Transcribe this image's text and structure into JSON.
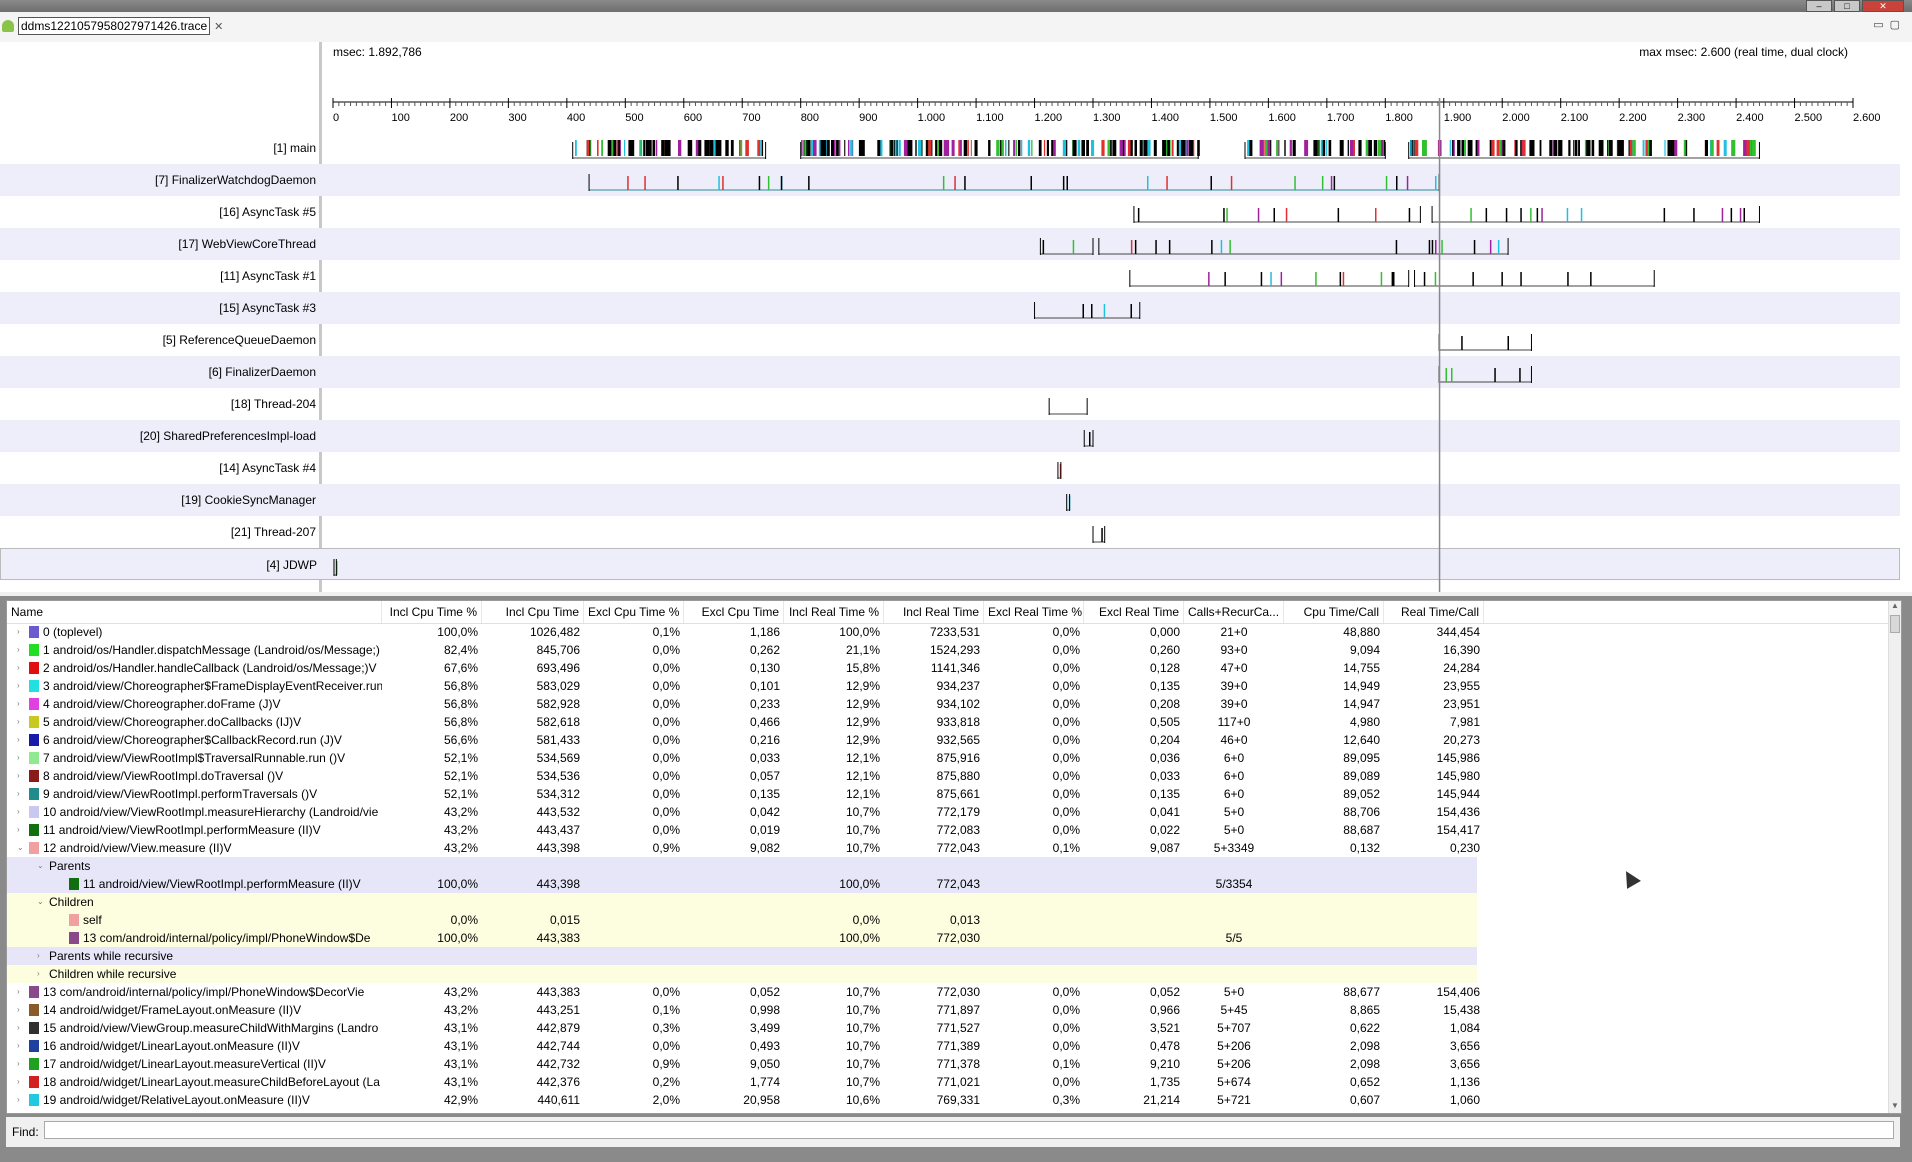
{
  "window": {
    "buttons": [
      "–",
      "□",
      "✕"
    ]
  },
  "tab": {
    "title": "ddms1221057958027971426.trace",
    "icon": "android-icon"
  },
  "timeline": {
    "msec_label": "msec: 1.892,786",
    "max_msec_label": "max msec: 2.600 (real time, dual clock)",
    "ticks": [
      "0",
      "100",
      "200",
      "300",
      "400",
      "500",
      "600",
      "700",
      "800",
      "900",
      "1.000",
      "1.100",
      "1.200",
      "1.300",
      "1.400",
      "1.500",
      "1.600",
      "1.700",
      "1.800",
      "1.900",
      "2.000",
      "2.100",
      "2.200",
      "2.300",
      "2.400",
      "2.500",
      "2.600"
    ],
    "max_ms": 2600,
    "cursor_ms": 1892.786,
    "threads": [
      {
        "name": "[1] main",
        "spans": [
          [
            410,
            740
          ],
          [
            800,
            1480
          ],
          [
            1560,
            1800
          ],
          [
            1840,
            2440
          ]
        ]
      },
      {
        "name": "[7] FinalizerWatchdogDaemon",
        "spans": [
          [
            438,
            1892
          ]
        ]
      },
      {
        "name": "[16] AsyncTask #5",
        "spans": [
          [
            1370,
            1860
          ],
          [
            1880,
            2440
          ]
        ]
      },
      {
        "name": "[17] WebViewCoreThread",
        "spans": [
          [
            1210,
            1300
          ],
          [
            1310,
            2010
          ]
        ]
      },
      {
        "name": "[11] AsyncTask #1",
        "spans": [
          [
            1363,
            1840
          ],
          [
            1850,
            2260
          ]
        ]
      },
      {
        "name": "[15] AsyncTask #3",
        "spans": [
          [
            1200,
            1380
          ]
        ]
      },
      {
        "name": "[5] ReferenceQueueDaemon",
        "spans": [
          [
            1892,
            2050
          ]
        ]
      },
      {
        "name": "[6] FinalizerDaemon",
        "spans": [
          [
            1892,
            2050
          ]
        ]
      },
      {
        "name": "[18] Thread-204",
        "spans": [
          [
            1225,
            1290
          ]
        ]
      },
      {
        "name": "[20] SharedPreferencesImpl-load",
        "spans": [
          [
            1285,
            1300
          ]
        ]
      },
      {
        "name": "[14] AsyncTask #4",
        "spans": [
          [
            1240,
            1245
          ]
        ]
      },
      {
        "name": "[19] CookieSyncManager",
        "spans": [
          [
            1255,
            1260
          ]
        ]
      },
      {
        "name": "[21] Thread-207",
        "spans": [
          [
            1300,
            1320
          ]
        ]
      },
      {
        "name": "[4] JDWP",
        "spans": [
          [
            0,
            4
          ]
        ]
      }
    ]
  },
  "table": {
    "headers": [
      "Name",
      "Incl Cpu Time %",
      "Incl Cpu Time",
      "Excl Cpu Time %",
      "Excl Cpu Time",
      "Incl Real Time %",
      "Incl Real Time",
      "Excl Real Time %",
      "Excl Real Time",
      "Calls+RecurCa...",
      "Cpu Time/Call",
      "Real Time/Call"
    ],
    "rows": [
      {
        "kind": "method",
        "twisty": "›",
        "color": "#6a5acd",
        "name": "0 (toplevel)",
        "cells": [
          "100,0%",
          "1026,482",
          "0,1%",
          "1,186",
          "100,0%",
          "7233,531",
          "0,0%",
          "0,000",
          "21+0",
          "48,880",
          "344,454"
        ]
      },
      {
        "kind": "method",
        "twisty": "›",
        "color": "#22dd22",
        "name": "1 android/os/Handler.dispatchMessage (Landroid/os/Message;)",
        "cells": [
          "82,4%",
          "845,706",
          "0,0%",
          "0,262",
          "21,1%",
          "1524,293",
          "0,0%",
          "0,260",
          "93+0",
          "9,094",
          "16,390"
        ]
      },
      {
        "kind": "method",
        "twisty": "›",
        "color": "#e01010",
        "name": "2 android/os/Handler.handleCallback (Landroid/os/Message;)V",
        "cells": [
          "67,6%",
          "693,496",
          "0,0%",
          "0,130",
          "15,8%",
          "1141,346",
          "0,0%",
          "0,128",
          "47+0",
          "14,755",
          "24,284"
        ]
      },
      {
        "kind": "method",
        "twisty": "›",
        "color": "#22e0e0",
        "name": "3 android/view/Choreographer$FrameDisplayEventReceiver.run",
        "cells": [
          "56,8%",
          "583,029",
          "0,0%",
          "0,101",
          "12,9%",
          "934,237",
          "0,0%",
          "0,135",
          "39+0",
          "14,949",
          "23,955"
        ]
      },
      {
        "kind": "method",
        "twisty": "›",
        "color": "#e040e0",
        "name": "4 android/view/Choreographer.doFrame (J)V",
        "cells": [
          "56,8%",
          "582,928",
          "0,0%",
          "0,233",
          "12,9%",
          "934,102",
          "0,0%",
          "0,208",
          "39+0",
          "14,947",
          "23,951"
        ]
      },
      {
        "kind": "method",
        "twisty": "›",
        "color": "#c8c820",
        "name": "5 android/view/Choreographer.doCallbacks (IJ)V",
        "cells": [
          "56,8%",
          "582,618",
          "0,0%",
          "0,466",
          "12,9%",
          "933,818",
          "0,0%",
          "0,505",
          "117+0",
          "4,980",
          "7,981"
        ]
      },
      {
        "kind": "method",
        "twisty": "›",
        "color": "#1a1aa8",
        "name": "6 android/view/Choreographer$CallbackRecord.run (J)V",
        "cells": [
          "56,6%",
          "581,433",
          "0,0%",
          "0,216",
          "12,9%",
          "932,565",
          "0,0%",
          "0,204",
          "46+0",
          "12,640",
          "20,273"
        ]
      },
      {
        "kind": "method",
        "twisty": "›",
        "color": "#90e890",
        "name": "7 android/view/ViewRootImpl$TraversalRunnable.run ()V",
        "cells": [
          "52,1%",
          "534,569",
          "0,0%",
          "0,033",
          "12,1%",
          "875,916",
          "0,0%",
          "0,036",
          "6+0",
          "89,095",
          "145,986"
        ]
      },
      {
        "kind": "method",
        "twisty": "›",
        "color": "#8b1a1a",
        "name": "8 android/view/ViewRootImpl.doTraversal ()V",
        "cells": [
          "52,1%",
          "534,536",
          "0,0%",
          "0,057",
          "12,1%",
          "875,880",
          "0,0%",
          "0,033",
          "6+0",
          "89,089",
          "145,980"
        ]
      },
      {
        "kind": "method",
        "twisty": "›",
        "color": "#208c8c",
        "name": "9 android/view/ViewRootImpl.performTraversals ()V",
        "cells": [
          "52,1%",
          "534,312",
          "0,0%",
          "0,135",
          "12,1%",
          "875,661",
          "0,0%",
          "0,135",
          "6+0",
          "89,052",
          "145,944"
        ]
      },
      {
        "kind": "method",
        "twisty": "›",
        "color": "#c8c8f0",
        "name": "10 android/view/ViewRootImpl.measureHierarchy (Landroid/vie",
        "cells": [
          "43,2%",
          "443,532",
          "0,0%",
          "0,042",
          "10,7%",
          "772,179",
          "0,0%",
          "0,041",
          "5+0",
          "88,706",
          "154,436"
        ]
      },
      {
        "kind": "method",
        "twisty": "›",
        "color": "#107010",
        "name": "11 android/view/ViewRootImpl.performMeasure (II)V",
        "cells": [
          "43,2%",
          "443,437",
          "0,0%",
          "0,019",
          "10,7%",
          "772,083",
          "0,0%",
          "0,022",
          "5+0",
          "88,687",
          "154,417"
        ]
      },
      {
        "kind": "method",
        "twisty": "⌄",
        "color": "#f0a0a0",
        "name": "12 android/view/View.measure (II)V",
        "cells": [
          "43,2%",
          "443,398",
          "0,9%",
          "9,082",
          "10,7%",
          "772,043",
          "0,1%",
          "9,087",
          "5+3349",
          "0,132",
          "0,230"
        ]
      },
      {
        "kind": "group-parents",
        "twisty": "⌄",
        "color": "",
        "name": "Parents",
        "cells": [
          "",
          "",
          "",
          "",
          "",
          "",
          "",
          "",
          "",
          "",
          ""
        ]
      },
      {
        "kind": "sub-parents",
        "twisty": "",
        "color": "#107010",
        "name": "11 android/view/ViewRootImpl.performMeasure (II)V",
        "cells": [
          "100,0%",
          "443,398",
          "",
          "",
          "100,0%",
          "772,043",
          "",
          "",
          "5/3354",
          "",
          ""
        ]
      },
      {
        "kind": "group-children",
        "twisty": "⌄",
        "color": "",
        "name": "Children",
        "cells": [
          "",
          "",
          "",
          "",
          "",
          "",
          "",
          "",
          "",
          "",
          ""
        ]
      },
      {
        "kind": "sub-children",
        "twisty": "",
        "color": "#f0a0a0",
        "name": "self",
        "cells": [
          "0,0%",
          "0,015",
          "",
          "",
          "0,0%",
          "0,013",
          "",
          "",
          "",
          "",
          ""
        ]
      },
      {
        "kind": "sub-children",
        "twisty": "",
        "color": "#8a4a8a",
        "name": "13 com/android/internal/policy/impl/PhoneWindow$De",
        "cells": [
          "100,0%",
          "443,383",
          "",
          "",
          "100,0%",
          "772,030",
          "",
          "",
          "5/5",
          "",
          ""
        ]
      },
      {
        "kind": "group-parents",
        "twisty": "›",
        "color": "",
        "name": "Parents while recursive",
        "cells": [
          "",
          "",
          "",
          "",
          "",
          "",
          "",
          "",
          "",
          "",
          ""
        ]
      },
      {
        "kind": "group-children",
        "twisty": "›",
        "color": "",
        "name": "Children while recursive",
        "cells": [
          "",
          "",
          "",
          "",
          "",
          "",
          "",
          "",
          "",
          "",
          ""
        ]
      },
      {
        "kind": "method",
        "twisty": "›",
        "color": "#8a4a8a",
        "name": "13 com/android/internal/policy/impl/PhoneWindow$DecorVie",
        "cells": [
          "43,2%",
          "443,383",
          "0,0%",
          "0,052",
          "10,7%",
          "772,030",
          "0,0%",
          "0,052",
          "5+0",
          "88,677",
          "154,406"
        ]
      },
      {
        "kind": "method",
        "twisty": "›",
        "color": "#8b5a2b",
        "name": "14 android/widget/FrameLayout.onMeasure (II)V",
        "cells": [
          "43,2%",
          "443,251",
          "0,1%",
          "0,998",
          "10,7%",
          "771,897",
          "0,0%",
          "0,966",
          "5+45",
          "8,865",
          "15,438"
        ]
      },
      {
        "kind": "method",
        "twisty": "›",
        "color": "#303030",
        "name": "15 android/view/ViewGroup.measureChildWithMargins (Landro",
        "cells": [
          "43,1%",
          "442,879",
          "0,3%",
          "3,499",
          "10,7%",
          "771,527",
          "0,0%",
          "3,521",
          "5+707",
          "0,622",
          "1,084"
        ]
      },
      {
        "kind": "method",
        "twisty": "›",
        "color": "#2040a0",
        "name": "16 android/widget/LinearLayout.onMeasure (II)V",
        "cells": [
          "43,1%",
          "442,744",
          "0,0%",
          "0,493",
          "10,7%",
          "771,389",
          "0,0%",
          "0,478",
          "5+206",
          "2,098",
          "3,656"
        ]
      },
      {
        "kind": "method",
        "twisty": "›",
        "color": "#20a020",
        "name": "17 android/widget/LinearLayout.measureVertical (II)V",
        "cells": [
          "43,1%",
          "442,732",
          "0,9%",
          "9,050",
          "10,7%",
          "771,378",
          "0,1%",
          "9,210",
          "5+206",
          "2,098",
          "3,656"
        ]
      },
      {
        "kind": "method",
        "twisty": "›",
        "color": "#d02020",
        "name": "18 android/widget/LinearLayout.measureChildBeforeLayout (La",
        "cells": [
          "43,1%",
          "442,376",
          "0,2%",
          "1,774",
          "10,7%",
          "771,021",
          "0,0%",
          "1,735",
          "5+674",
          "0,652",
          "1,136"
        ]
      },
      {
        "kind": "method",
        "twisty": "›",
        "color": "#20c8e0",
        "name": "19 android/widget/RelativeLayout.onMeasure (II)V",
        "cells": [
          "42,9%",
          "440,611",
          "2,0%",
          "20,958",
          "10,6%",
          "769,331",
          "0,3%",
          "21,214",
          "5+721",
          "0,607",
          "1,060"
        ]
      }
    ]
  },
  "find": {
    "label": "Find:",
    "value": ""
  }
}
